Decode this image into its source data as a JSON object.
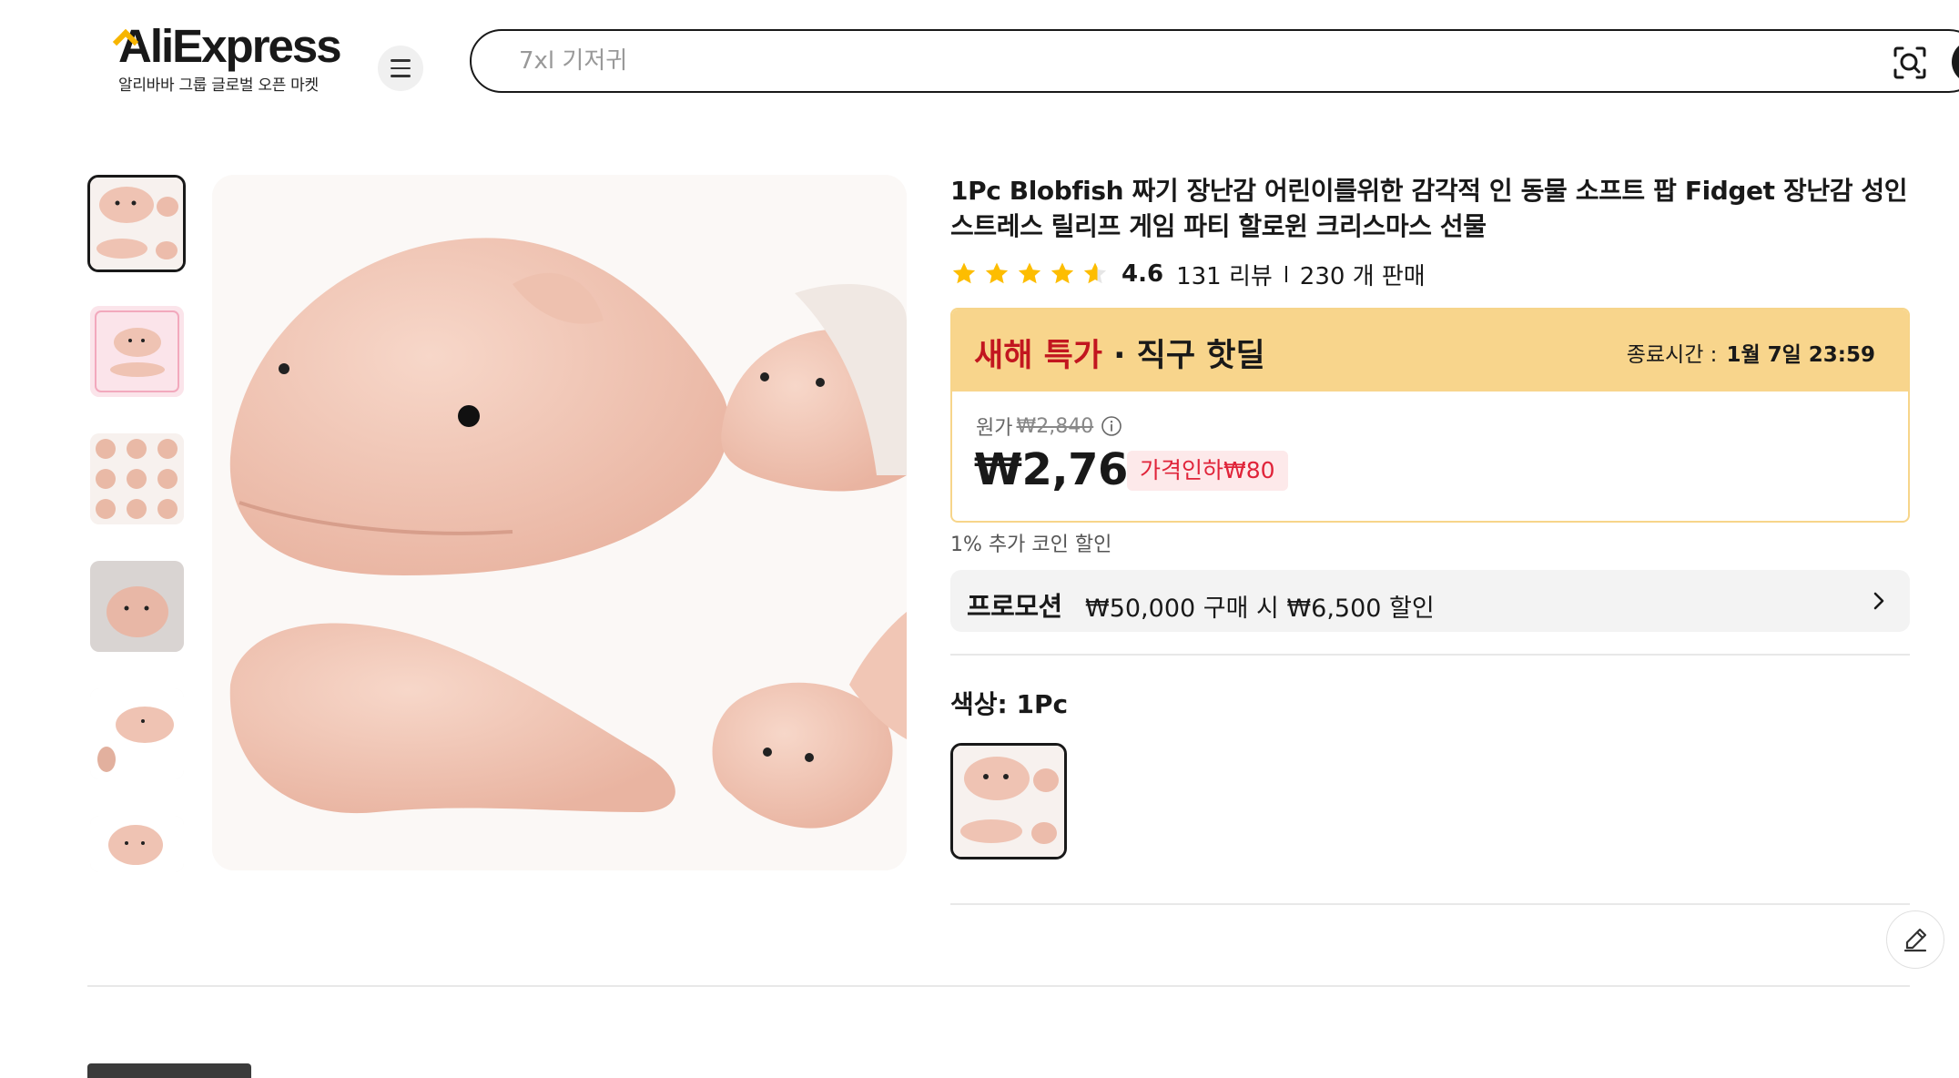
{
  "header": {
    "logo_text": "AliExpress",
    "logo_tagline": "알리바바 그룹 글로벌 오픈 마켓",
    "search_placeholder": "7xl 기저귀",
    "brand_color": "#191919",
    "accent_color": "#f7b500"
  },
  "gallery": {
    "thumbnails": [
      {
        "alt": "blobfish squishy toys"
      },
      {
        "alt": "blobfish packaging card"
      },
      {
        "alt": "blobfish squeeze grid"
      },
      {
        "alt": "blobfish in hand"
      },
      {
        "alt": "blobfish side view"
      },
      {
        "alt": "blobfish front view"
      }
    ],
    "main_image_alt": "Blobfish squishy fidget toy"
  },
  "product": {
    "title": "1Pc Blobfish 짜기 장난감 어린이를위한 감각적 인 동물 소프트 팝 Fidget 장난감 성인 스트레스 릴리프 게임 파티 할로윈 크리스마스 선물",
    "rating": "4.6",
    "reviews": "131 리뷰",
    "sold": "230 개 판매",
    "star_fill": [
      1,
      1,
      1,
      1,
      0.6
    ]
  },
  "deal": {
    "title_red": "새해 특가",
    "title_rest": " · 직구 핫딜",
    "end_label": "종료시간 :",
    "end_time": "1월 7일 23:59",
    "original_label": "원가",
    "original_price": "₩2,840",
    "price": "₩2,760",
    "discount": "가격인하₩80",
    "header_color": "#f8d58c",
    "red_color": "#c2161f"
  },
  "coin_discount": "1% 추가 코인 할인",
  "promotion": {
    "label": "프로모션",
    "text": "₩50,000 구매 시 ₩6,500 할인"
  },
  "variant": {
    "label": "색상: 1Pc"
  }
}
